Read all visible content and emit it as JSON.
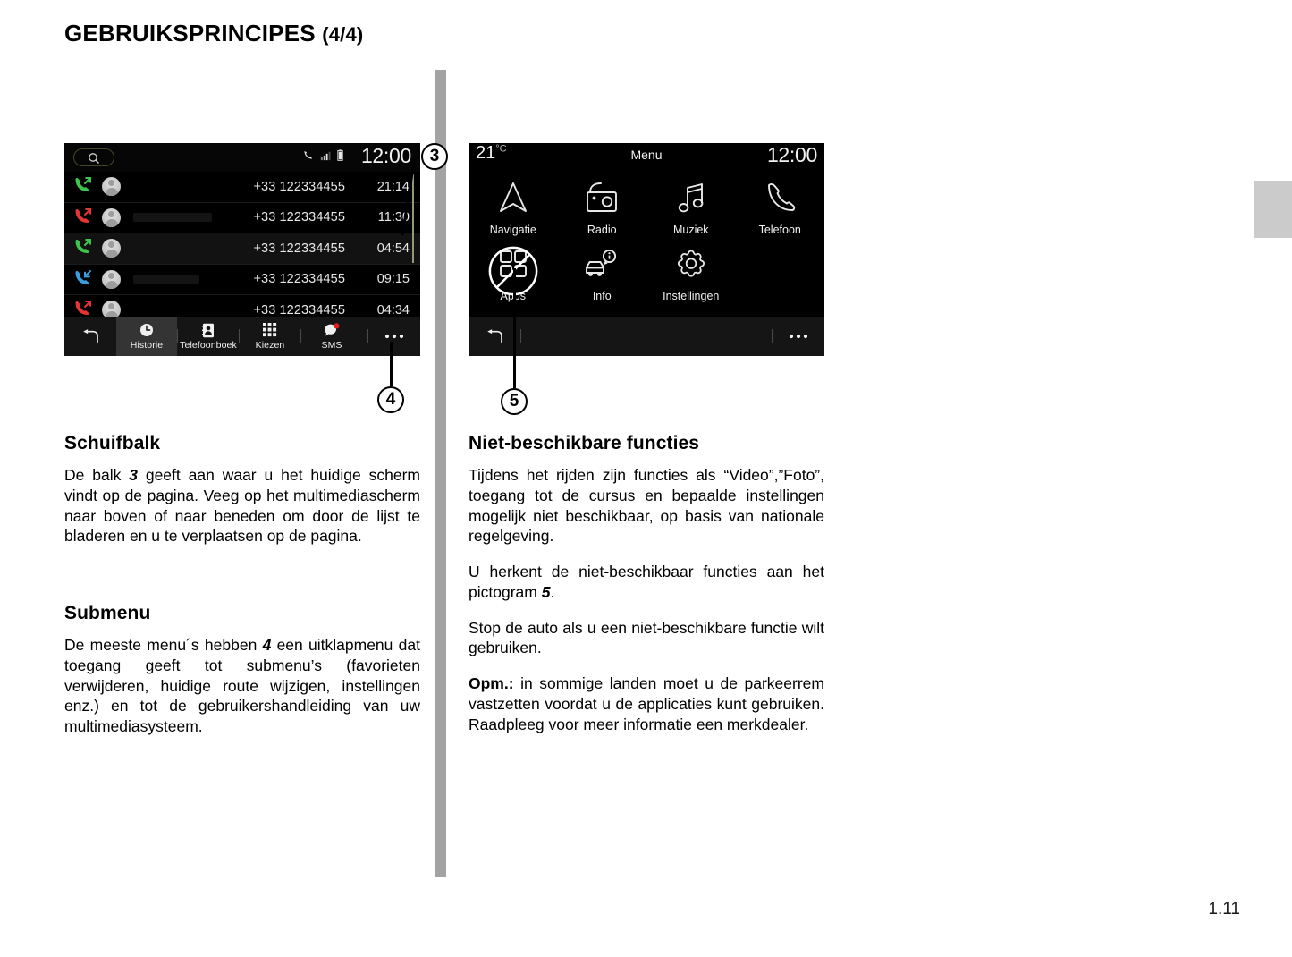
{
  "page": {
    "title_main": "GEBRUIKSPRINCIPES",
    "title_part": "(4/4)",
    "number": "1.11"
  },
  "callouts": {
    "scrollbar": "3",
    "submenu": "4",
    "unavailable": "5"
  },
  "phone_screen": {
    "name": "call-history-screen",
    "search_icon": "search-icon",
    "status_icons": [
      "phone-icon",
      "signal-icon",
      "battery-icon"
    ],
    "clock": "12:00",
    "rows": [
      {
        "direction": "outgoing",
        "color": "#3cc74a",
        "number": "+33 122334455",
        "time": "21:14",
        "redacted_width": 0,
        "highlighted": false
      },
      {
        "direction": "missed",
        "color": "#e53535",
        "number": "+33 122334455",
        "time": "11:30",
        "redacted_width": 88,
        "highlighted": false
      },
      {
        "direction": "outgoing",
        "color": "#3cc74a",
        "number": "+33 122334455",
        "time": "04:54",
        "redacted_width": 0,
        "highlighted": true
      },
      {
        "direction": "incoming",
        "color": "#3a9fe0",
        "number": "+33 122334455",
        "time": "09:15",
        "redacted_width": 74,
        "highlighted": false
      },
      {
        "direction": "missed",
        "color": "#e53535",
        "number": "+33 122334455",
        "time": "04:34",
        "redacted_width": 0,
        "highlighted": false
      }
    ],
    "bottom_bar": {
      "back_icon": "back-arrow-icon",
      "tabs": [
        {
          "label": "Historie",
          "icon": "clock-icon",
          "active": true,
          "badge": false
        },
        {
          "label": "Telefoonboek",
          "icon": "contacts-icon",
          "active": false,
          "badge": false
        },
        {
          "label": "Kiezen",
          "icon": "keypad-icon",
          "active": false,
          "badge": false
        },
        {
          "label": "SMS",
          "icon": "message-icon",
          "active": false,
          "badge": true
        }
      ],
      "more_icon": "more-options-icon"
    }
  },
  "menu_screen": {
    "name": "main-menu-screen",
    "temperature": "21",
    "temperature_unit": "°C",
    "title": "Menu",
    "clock": "12:00",
    "items_row1": [
      {
        "label": "Navigatie",
        "icon": "navigation-arrow-icon",
        "disabled": false
      },
      {
        "label": "Radio",
        "icon": "radio-icon",
        "disabled": false
      },
      {
        "label": "Muziek",
        "icon": "music-note-icon",
        "disabled": false
      },
      {
        "label": "Telefoon",
        "icon": "phone-handset-icon",
        "disabled": false
      }
    ],
    "items_row2": [
      {
        "label": "Apps",
        "icon": "apps-grid-icon",
        "disabled": true
      },
      {
        "label": "Info",
        "icon": "car-info-icon",
        "disabled": false
      },
      {
        "label": "Instellingen",
        "icon": "gear-icon",
        "disabled": false
      }
    ],
    "bottom_bar": {
      "back_icon": "back-arrow-icon",
      "more_icon": "more-options-icon"
    }
  },
  "left_column": {
    "section1": {
      "heading": "Schuifbalk",
      "paragraph": "De balk 3 geeft aan waar u het huidige scherm vindt op de pagina. Veeg op het multimediascherm naar boven of naar beneden om door de lijst te bladeren en u te verplaatsen op de pagina.",
      "p_before": "De balk ",
      "p_number": "3",
      "p_after": " geeft aan waar u het huidige scherm vindt op de pagina. Veeg op het mul­timediascherm naar boven of naar beneden om door de lijst te bladeren en u te verplaat­sen op de pagina."
    },
    "section2": {
      "heading": "Submenu",
      "p_before": "De meeste menu´s hebben ",
      "p_number": "4",
      "p_after": " een uitklap­menu dat toegang geeft tot submenu’s (favorieten verwijderen, huidige route wijzigen, instellingen enz.) en tot de gebruikershand­leiding van uw multimediasysteem."
    }
  },
  "right_column": {
    "heading": "Niet-beschikbare functies",
    "paragraph1": "Tijdens het rijden zijn functies als “Video”,”Foto”, toegang tot de cursus en bepaalde instellingen mogelijk niet beschikbaar, op basis van nationale regelgeving.",
    "paragraph2_before": "U herkent de niet-beschikbaar functies aan het pictogram ",
    "paragraph2_number": "5",
    "paragraph2_after": ".",
    "paragraph3": "Stop de auto als u een niet-beschikbare functie wilt gebruiken.",
    "paragraph4_label": "Opm.:",
    "paragraph4_text": " in sommige landen moet u de parkeerrem vastzetten voordat u de applicaties kunt gebruiken. Raadpleeg voor meer informatie een merkdealer."
  }
}
